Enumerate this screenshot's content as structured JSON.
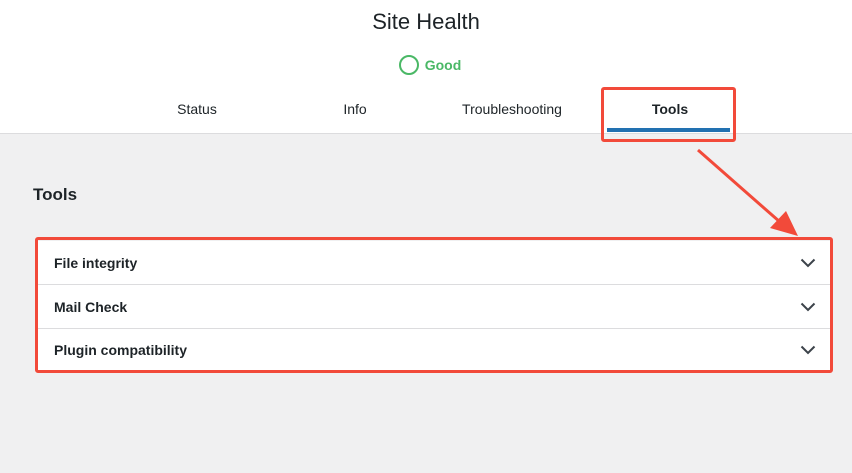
{
  "header": {
    "title": "Site Health",
    "status": {
      "label": "Good",
      "color": "#4ab866",
      "icon": "status-circle-icon"
    }
  },
  "tabs": [
    {
      "label": "Status"
    },
    {
      "label": "Info"
    },
    {
      "label": "Troubleshooting"
    },
    {
      "label": "Tools",
      "active": true
    }
  ],
  "main": {
    "section_title": "Tools",
    "accordion": [
      {
        "label": "File integrity",
        "icon": "chevron-down-icon"
      },
      {
        "label": "Mail Check",
        "icon": "chevron-down-icon"
      },
      {
        "label": "Plugin compatibility",
        "icon": "chevron-down-icon"
      }
    ]
  },
  "colors": {
    "accent": "#2271b1",
    "annotation": "#f24a3a",
    "background": "#f0f0f1"
  }
}
